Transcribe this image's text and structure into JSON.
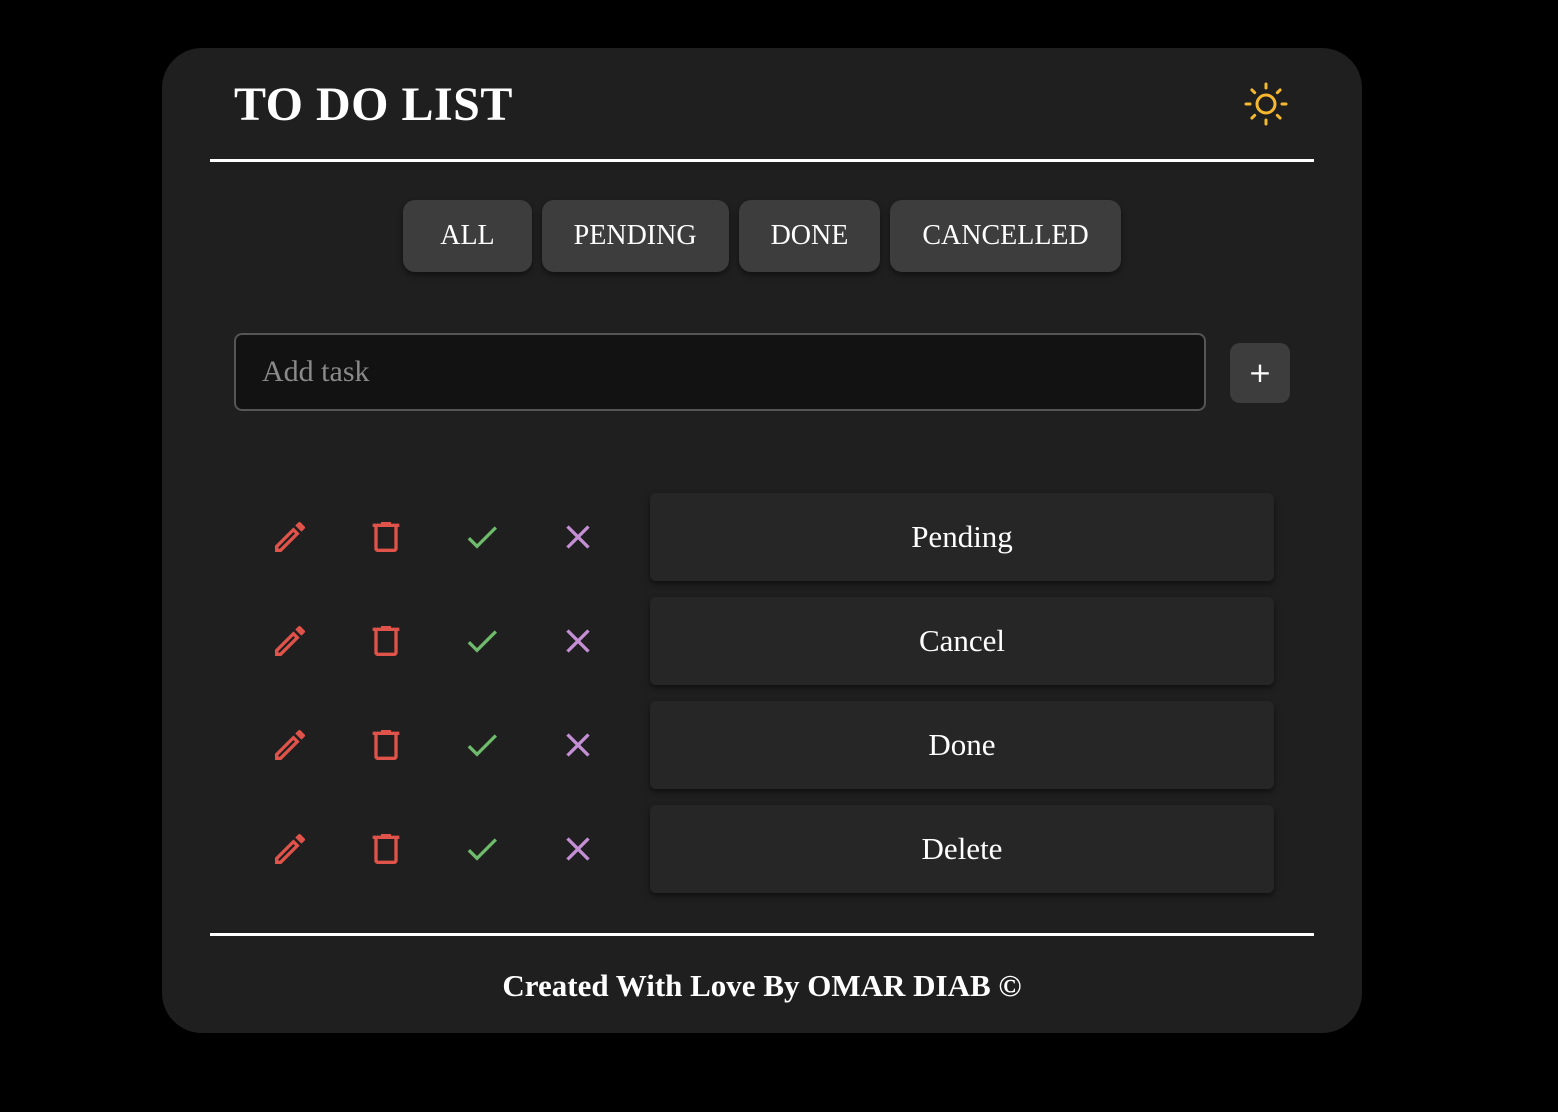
{
  "app": {
    "title": "TO DO LIST",
    "theme_icon": "sun-icon"
  },
  "filters": [
    {
      "label": "ALL"
    },
    {
      "label": "PENDING"
    },
    {
      "label": "DONE"
    },
    {
      "label": "CANCELLED"
    }
  ],
  "new_task": {
    "placeholder": "Add task",
    "value": "",
    "add_label": "+"
  },
  "task_actions": {
    "edit_icon": "pencil-icon",
    "delete_icon": "trash-icon",
    "done_icon": "check-icon",
    "cancel_icon": "x-icon"
  },
  "tasks": [
    {
      "label": "Pending"
    },
    {
      "label": "Cancel"
    },
    {
      "label": "Done"
    },
    {
      "label": "Delete"
    }
  ],
  "footer": {
    "text": "Created With Love By OMAR DIAB ©"
  },
  "colors": {
    "background": "#000000",
    "card": "#1f1f1f",
    "sun": "#f5b82e",
    "edit": "#e0534a",
    "delete": "#e0534a",
    "done": "#6fbb6c",
    "cancel": "#c58fd6"
  }
}
